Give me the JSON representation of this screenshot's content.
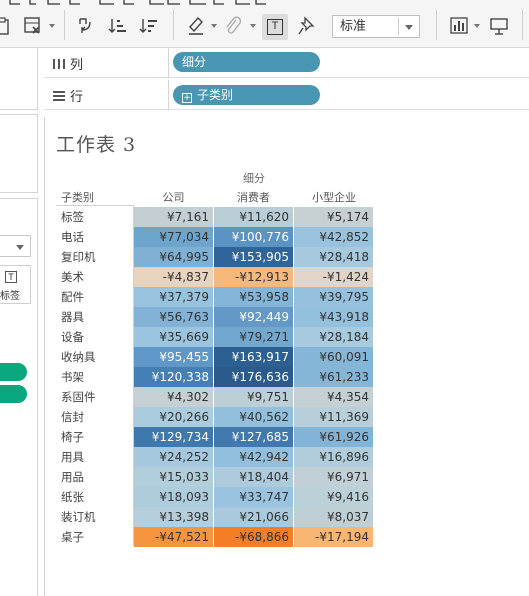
{
  "toolbar": {
    "fit_select_label": "标准",
    "t_button_label": "T",
    "icons": [
      "paste-icon",
      "clear-sheet-icon",
      "swap-rows-columns-icon",
      "sort-ascending-icon",
      "sort-descending-icon",
      "highlight-icon",
      "attach-icon",
      "show-mark-labels-icon",
      "fix-axes-pin-icon",
      "show-me-icon",
      "presentation-icon"
    ]
  },
  "left_panel": {
    "card_label": "标签",
    "card_icon_text": "T"
  },
  "shelves": {
    "columns": {
      "label": "列",
      "pill": "细分"
    },
    "rows": {
      "label": "行",
      "pill": "子类别",
      "pill_prefix": "+"
    }
  },
  "worksheet": {
    "title": "工作表 3",
    "column_group": "细分",
    "row_header": "子类别",
    "columns": [
      "公司",
      "消费者",
      "小型企业"
    ],
    "rows": [
      {
        "label": "标签",
        "values": [
          "¥7,161",
          "¥11,620",
          "¥5,174"
        ]
      },
      {
        "label": "电话",
        "values": [
          "¥77,034",
          "¥100,776",
          "¥42,852"
        ]
      },
      {
        "label": "复印机",
        "values": [
          "¥64,995",
          "¥153,905",
          "¥28,418"
        ]
      },
      {
        "label": "美术",
        "values": [
          "-¥4,837",
          "-¥12,913",
          "-¥1,424"
        ]
      },
      {
        "label": "配件",
        "values": [
          "¥37,379",
          "¥53,958",
          "¥39,795"
        ]
      },
      {
        "label": "器具",
        "values": [
          "¥56,763",
          "¥92,449",
          "¥43,918"
        ]
      },
      {
        "label": "设备",
        "values": [
          "¥35,669",
          "¥79,271",
          "¥28,184"
        ]
      },
      {
        "label": "收纳具",
        "values": [
          "¥95,455",
          "¥163,917",
          "¥60,091"
        ]
      },
      {
        "label": "书架",
        "values": [
          "¥120,338",
          "¥176,636",
          "¥61,233"
        ]
      },
      {
        "label": "系固件",
        "values": [
          "¥4,302",
          "¥9,751",
          "¥4,354"
        ]
      },
      {
        "label": "信封",
        "values": [
          "¥20,266",
          "¥40,562",
          "¥11,369"
        ]
      },
      {
        "label": "椅子",
        "values": [
          "¥129,734",
          "¥127,685",
          "¥61,926"
        ]
      },
      {
        "label": "用具",
        "values": [
          "¥24,252",
          "¥42,942",
          "¥16,896"
        ]
      },
      {
        "label": "用品",
        "values": [
          "¥15,033",
          "¥18,404",
          "¥6,971"
        ]
      },
      {
        "label": "纸张",
        "values": [
          "¥18,093",
          "¥33,747",
          "¥9,416"
        ]
      },
      {
        "label": "装订机",
        "values": [
          "¥13,398",
          "¥21,066",
          "¥8,037"
        ]
      },
      {
        "label": "桌子",
        "values": [
          "-¥47,521",
          "-¥68,866",
          "-¥17,194"
        ]
      }
    ]
  },
  "cell_colors": [
    [
      "#c3cfd3",
      "#b9cdd6",
      "#c6d0d3"
    ],
    [
      "#6ea5cd",
      "#5b94c4",
      "#98c2de"
    ],
    [
      "#7eb0d3",
      "#2f6598",
      "#a6c9de"
    ],
    [
      "#ead3bd",
      "#f7b87b",
      "#e2d5c8"
    ],
    [
      "#98c3df",
      "#83b5d8",
      "#95c1de"
    ],
    [
      "#82b3d6",
      "#6499c7",
      "#93c0dd"
    ],
    [
      "#9bc4df",
      "#72a8d0",
      "#a7cade"
    ],
    [
      "#5f98c8",
      "#2c5f92",
      "#85b6d8"
    ],
    [
      "#467fb3",
      "#2b5a8c",
      "#85b6d8"
    ],
    [
      "#c4d0d3",
      "#bccfd6",
      "#c4d0d3"
    ],
    [
      "#abcbde",
      "#92bfdc",
      "#b8cfd9"
    ],
    [
      "#3f78ad",
      "#4179ae",
      "#82b4d7"
    ],
    [
      "#a5c8de",
      "#91bfdd",
      "#b1cddb"
    ],
    [
      "#b1cedc",
      "#adcbdc",
      "#c0d0d6"
    ],
    [
      "#aecddc",
      "#99c3df",
      "#bcd0d7"
    ],
    [
      "#b5cedb",
      "#a9cadd",
      "#bed0d6"
    ],
    [
      "#f7953f",
      "#f37e26",
      "#f9b672"
    ]
  ]
}
